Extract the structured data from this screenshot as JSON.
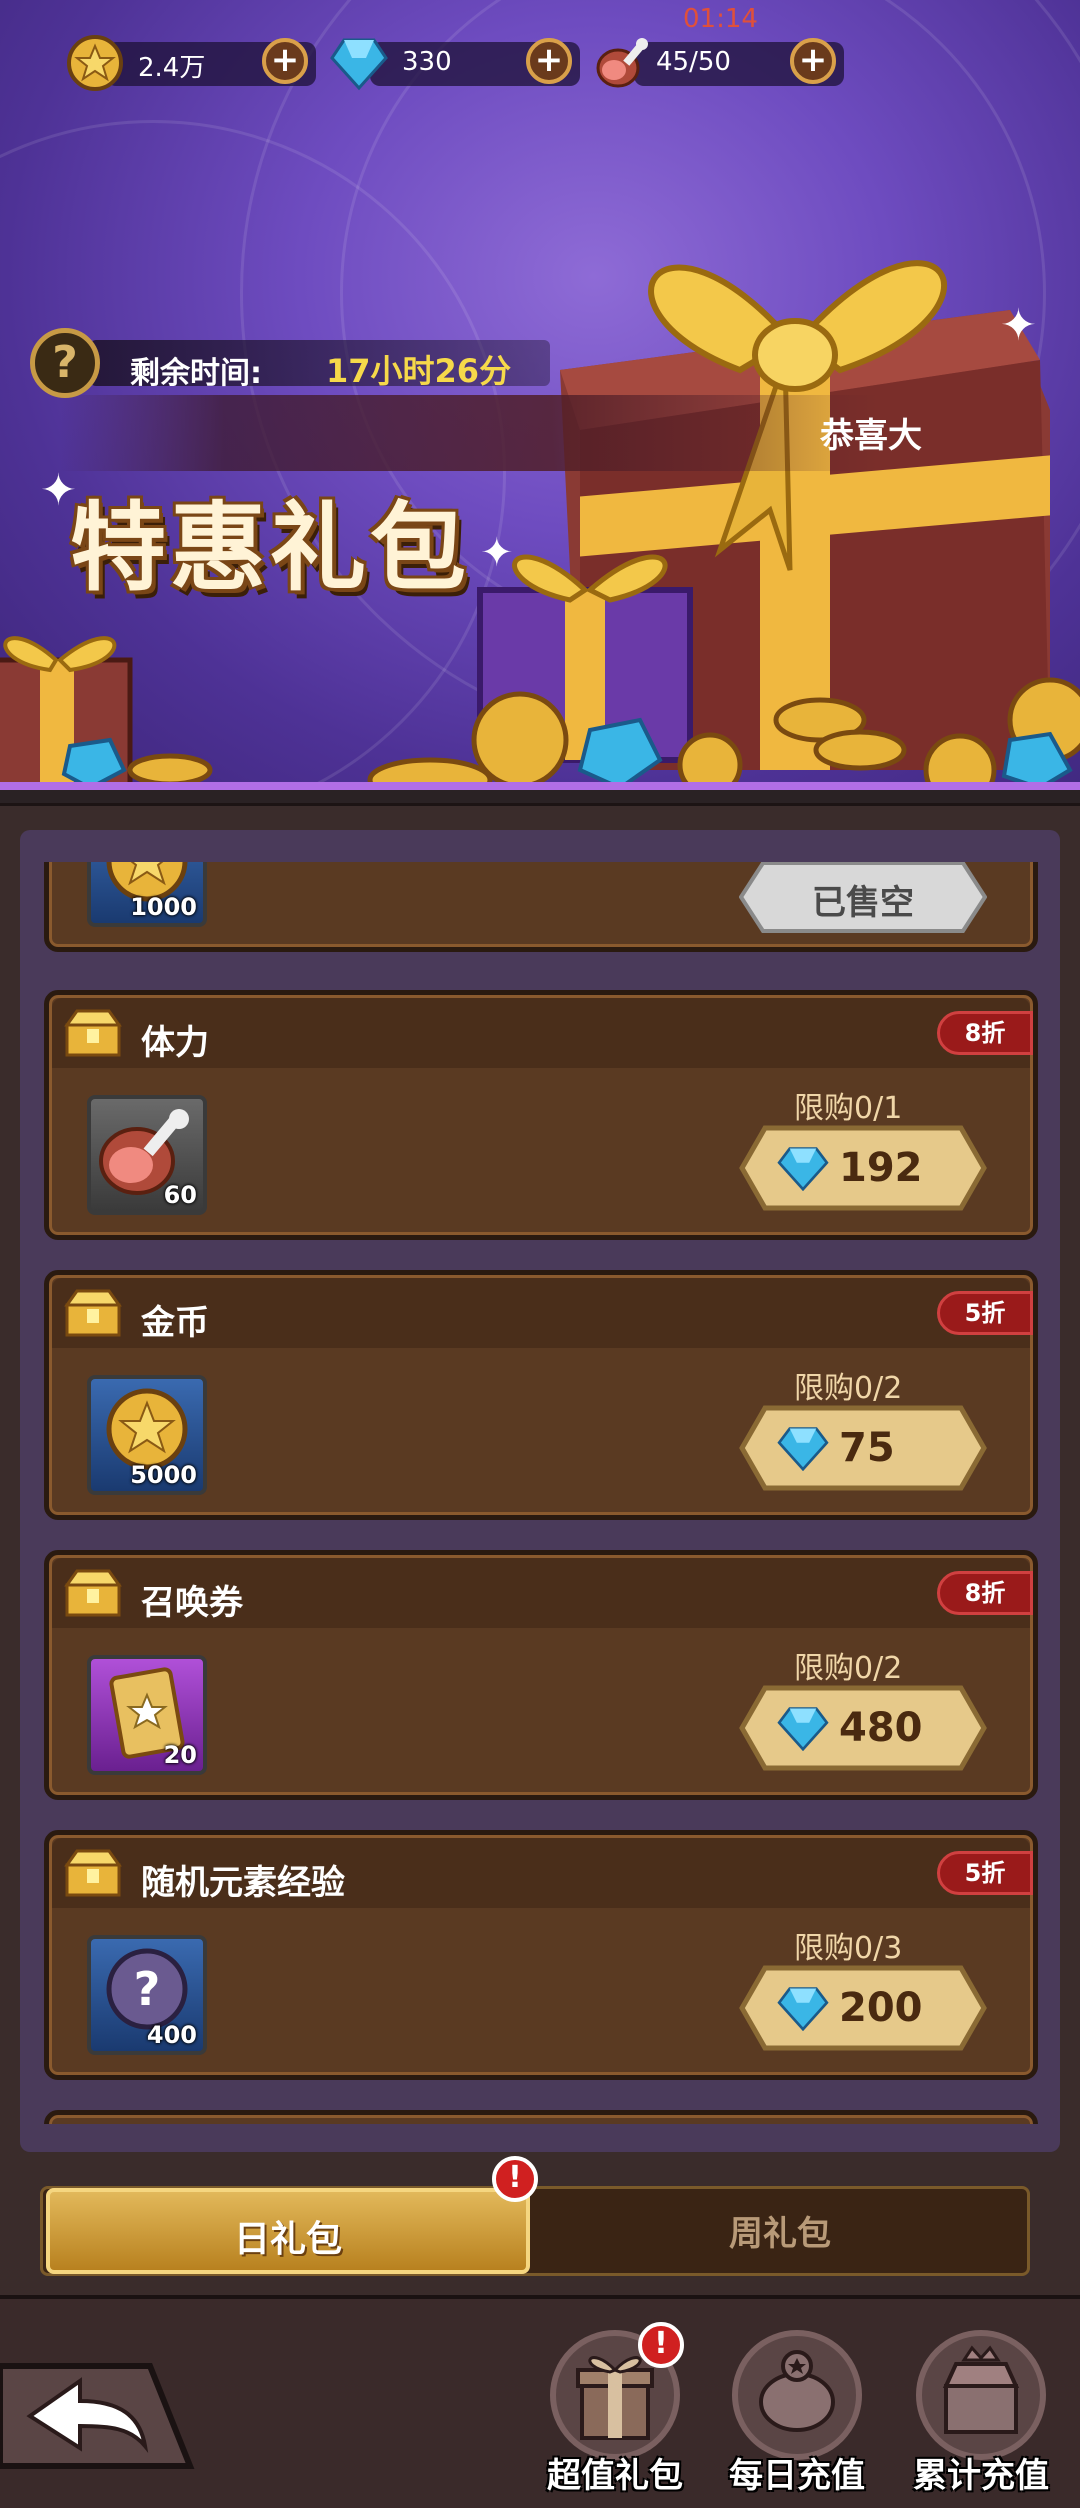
{
  "status_bar": {
    "clock": "01:14"
  },
  "resources": [
    {
      "icon": "gold-coin-icon",
      "value": "2.4万"
    },
    {
      "icon": "diamond-icon",
      "value": "330"
    },
    {
      "icon": "meat-stamina-icon",
      "value": "45/50"
    }
  ],
  "banner": {
    "timer_label": "剩余时间:",
    "timer_value": "17小时26分",
    "congrats": "恭喜大",
    "title": "特惠礼包"
  },
  "packs": [
    {
      "name": "",
      "item_icon": "gold-coin-icon",
      "item_qty": "1000",
      "status": "已售空"
    },
    {
      "name": "体力",
      "discount": "8折",
      "item_icon": "meat-stamina-icon",
      "item_qty": "60",
      "limit": "限购0/1",
      "price": "192"
    },
    {
      "name": "金币",
      "discount": "5折",
      "item_icon": "gold-coin-icon",
      "item_qty": "5000",
      "limit": "限购0/2",
      "price": "75"
    },
    {
      "name": "召唤券",
      "discount": "8折",
      "item_icon": "summon-ticket-icon",
      "item_qty": "20",
      "limit": "限购0/2",
      "price": "480"
    },
    {
      "name": "随机元素经验",
      "discount": "5折",
      "item_icon": "mystery-orb-icon",
      "item_qty": "400",
      "limit": "限购0/3",
      "price": "200"
    }
  ],
  "tabs": {
    "daily": "日礼包",
    "weekly": "周礼包",
    "daily_alert": "!"
  },
  "bottom_nav": [
    {
      "label": "超值礼包",
      "icon": "gift-box-icon",
      "alert": "!"
    },
    {
      "label": "每日充值",
      "icon": "piggy-bank-icon"
    },
    {
      "label": "累计充值",
      "icon": "treasure-chest-icon"
    }
  ],
  "colors": {
    "banner_purple": "#6e4cc0",
    "card_brown": "#5a3a22",
    "gold_accent": "#d9a04a",
    "timer_yellow": "#f6d94a",
    "discount_red": "#9a1a1a"
  }
}
